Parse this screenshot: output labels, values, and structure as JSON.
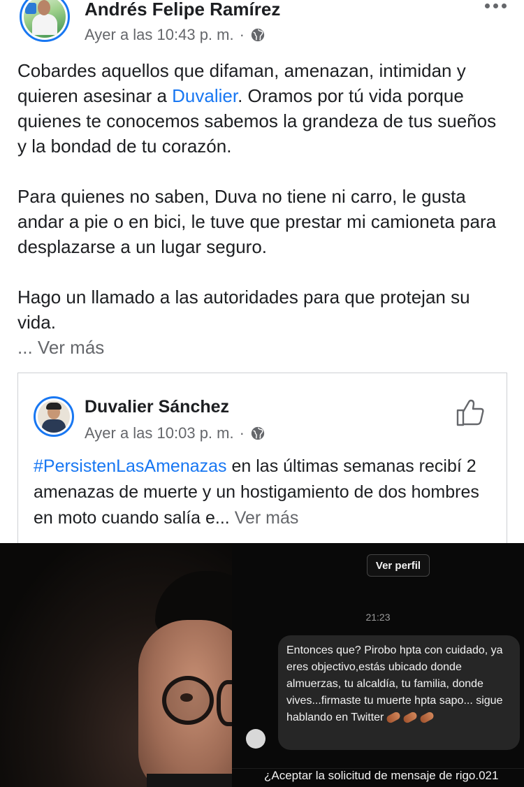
{
  "post": {
    "author": "Andrés Felipe Ramírez",
    "timestamp": "Ayer a las 10:43 p. m.",
    "separator": "·",
    "privacy_icon": "globe-icon",
    "more_icon": "more-options-icon",
    "body": {
      "p1_before": "Cobardes aquellos que difaman, amenazan, intimidan y quieren asesinar a ",
      "p1_link": "Duvalier",
      "p1_after": ". Oramos por tú vida porque quienes te conocemos sabemos la grandeza de tus sueños y la bondad de tu corazón.",
      "p2": "Para quienes no saben, Duva no tiene ni carro, le gusta andar a pie o en bici, le tuve que prestar mi camioneta para desplazarse a un lugar seguro.",
      "p3": "Hago un llamado a las autoridades para que protejan su vida.",
      "ellipsis": "... ",
      "see_more": "Ver más"
    }
  },
  "shared_post": {
    "author": "Duvalier Sánchez",
    "timestamp": "Ayer a las 10:03 p. m.",
    "separator": "·",
    "privacy_icon": "globe-icon",
    "like_icon": "thumbs-up-icon",
    "hashtag": "#PersistenLasAmenazas",
    "text": " en las últimas semanas recibí 2 amenazas de muerte y un hostigamiento de dos hombres en moto cuando salía e... ",
    "see_more": "Ver más"
  },
  "media": {
    "view_profile": "Ver perfil",
    "time": "21:23",
    "message": "Entonces que? Pirobo hpta con cuidado, ya eres objectivo,estás ubicado donde almuerzas, tu alcaldía, tu familia, donde vives...firmaste tu muerte hpta sapo...  sigue hablando en Twitter",
    "accept_request": "¿Aceptar la solicitud de mensaje de rigo.021"
  },
  "colors": {
    "link": "#1877f2",
    "secondary_text": "#65676b",
    "primary_text": "#1c1e21"
  }
}
